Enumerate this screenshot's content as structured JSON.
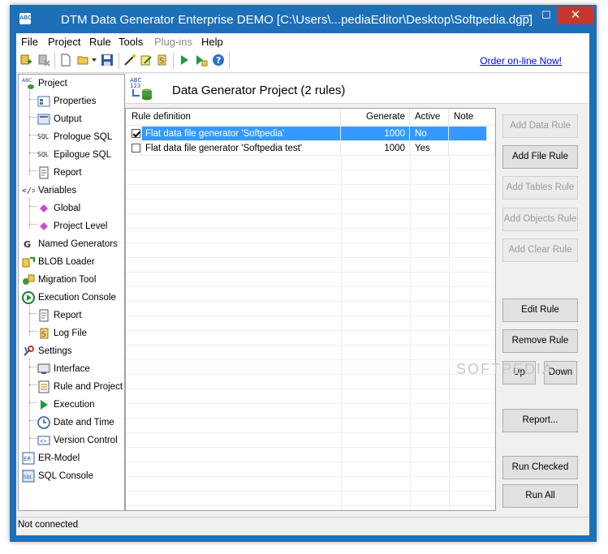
{
  "window": {
    "title": "DTM Data Generator Enterprise DEMO [C:\\Users\\...pediaEditor\\Desktop\\Softpedia.dgp]",
    "app_icon_text": "ABC",
    "minimize": "—",
    "maximize": "☐",
    "close": "✕"
  },
  "menu": [
    "File",
    "Project",
    "Rule",
    "Tools",
    "Plug-ins",
    "Help"
  ],
  "menu_disabled": [
    "Plug-ins"
  ],
  "toolbar": {
    "order_link": "Order on-line Now!"
  },
  "tree": [
    {
      "label": "Project",
      "icon": "project-icon"
    },
    {
      "label": "Properties",
      "icon": "properties-icon"
    },
    {
      "label": "Output",
      "icon": "output-icon"
    },
    {
      "label": "Prologue SQL",
      "icon": "sql-icon"
    },
    {
      "label": "Epilogue SQL",
      "icon": "sql-icon"
    },
    {
      "label": "Report",
      "icon": "report-icon"
    },
    {
      "label": "Variables",
      "icon": "variables-icon"
    },
    {
      "label": "Global",
      "icon": "diamond-icon"
    },
    {
      "label": "Project Level",
      "icon": "diamond-icon"
    },
    {
      "label": "Named Generators",
      "icon": "generators-icon"
    },
    {
      "label": "BLOB Loader",
      "icon": "blob-icon"
    },
    {
      "label": "Migration Tool",
      "icon": "migration-icon"
    },
    {
      "label": "Execution Console",
      "icon": "console-icon"
    },
    {
      "label": "Report",
      "icon": "report-icon"
    },
    {
      "label": "Log File",
      "icon": "log-file-icon"
    },
    {
      "label": "Settings",
      "icon": "settings-icon"
    },
    {
      "label": "Interface",
      "icon": "interface-icon"
    },
    {
      "label": "Rule and Project",
      "icon": "rule-project-icon"
    },
    {
      "label": "Execution",
      "icon": "play-icon"
    },
    {
      "label": "Date and Time",
      "icon": "clock-icon"
    },
    {
      "label": "Version Control",
      "icon": "version-control-icon"
    },
    {
      "label": "ER-Model",
      "icon": "er-model-icon"
    },
    {
      "label": "SQL Console",
      "icon": "sql-console-icon"
    }
  ],
  "header": {
    "title": "Data Generator Project (2 rules)",
    "icon_text": "ABC 123"
  },
  "grid": {
    "columns": [
      "Rule definition",
      "Generate",
      "Active",
      "Note"
    ],
    "rows": [
      {
        "checked": true,
        "definition": "Flat data file generator 'Softpedia'",
        "generate": "1000",
        "active": "No",
        "note": ""
      },
      {
        "checked": false,
        "definition": "Flat data file generator 'Softpedia test'",
        "generate": "1000",
        "active": "Yes",
        "note": ""
      }
    ]
  },
  "buttons": {
    "add_data_rule": "Add Data Rule",
    "add_file_rule": "Add File Rule",
    "add_tables_rule": "Add Tables Rule",
    "add_objects_rule": "Add Objects Rule",
    "add_clear_rule": "Add Clear Rule",
    "edit_rule": "Edit Rule",
    "remove_rule": "Remove Rule",
    "up": "Up",
    "down": "Down",
    "report": "Report...",
    "run_checked": "Run Checked",
    "run_all": "Run All"
  },
  "status": "Not connected",
  "watermark": "SOFTPEDIA",
  "colors": {
    "titlebar": "#1e6fb8",
    "selection": "#3399ff",
    "close_button": "#c7372f"
  }
}
